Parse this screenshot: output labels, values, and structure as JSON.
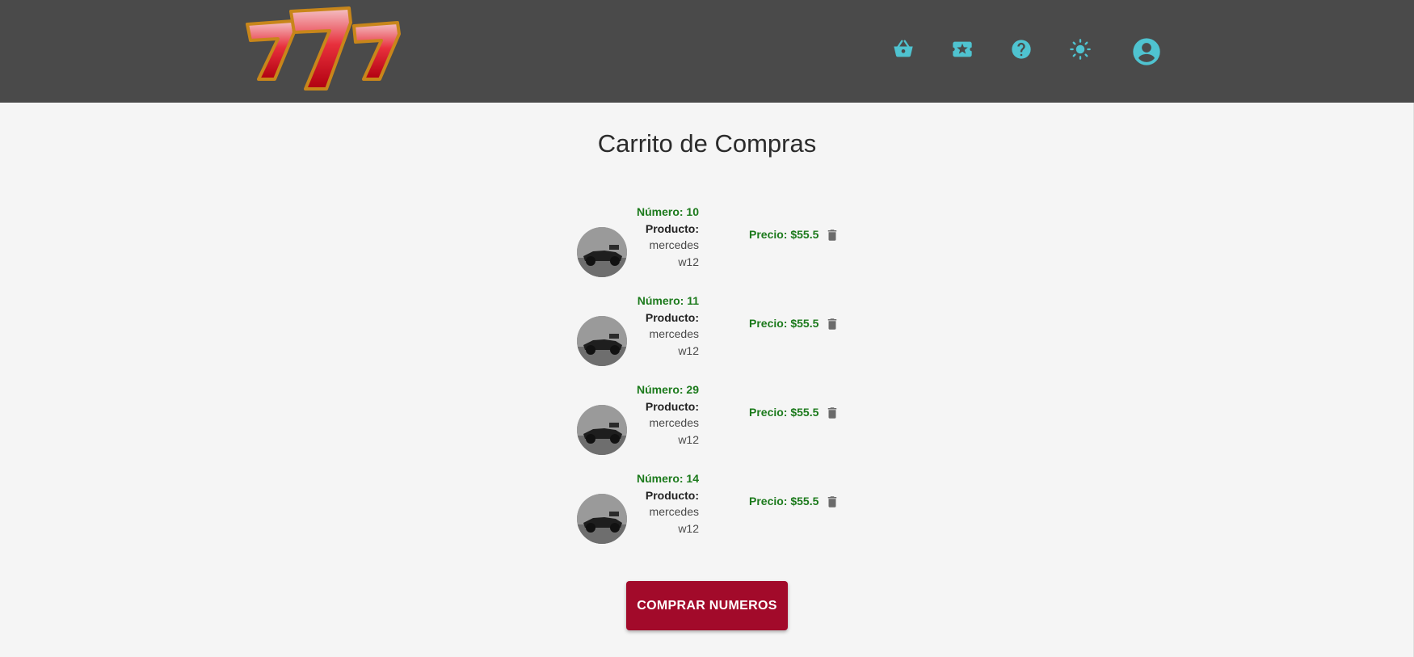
{
  "colors": {
    "header_bg": "#4a4a4a",
    "icon_accent": "#4fc3d0",
    "page_bg": "#f5f5f5",
    "price_green": "#1c7a1c",
    "button_red": "#a20a2a"
  },
  "header": {
    "logo": "777",
    "nav_icons": [
      "basket-icon",
      "ticket-star-icon",
      "help-icon",
      "brightness-icon",
      "account-circle-icon"
    ]
  },
  "page": {
    "title": "Carrito de Compras"
  },
  "cart": {
    "items": [
      {
        "numero": "Número: 10",
        "producto_label": "Producto:",
        "producto_value": "mercedes w12",
        "precio": "Precio: $55.5"
      },
      {
        "numero": "Número: 11",
        "producto_label": "Producto:",
        "producto_value": "mercedes w12",
        "precio": "Precio: $55.5"
      },
      {
        "numero": "Número: 29",
        "producto_label": "Producto:",
        "producto_value": "mercedes w12",
        "precio": "Precio: $55.5"
      },
      {
        "numero": "Número: 14",
        "producto_label": "Producto:",
        "producto_value": "mercedes w12",
        "precio": "Precio: $55.5"
      }
    ]
  },
  "actions": {
    "buy_label": "COMPRAR NUMEROS"
  }
}
